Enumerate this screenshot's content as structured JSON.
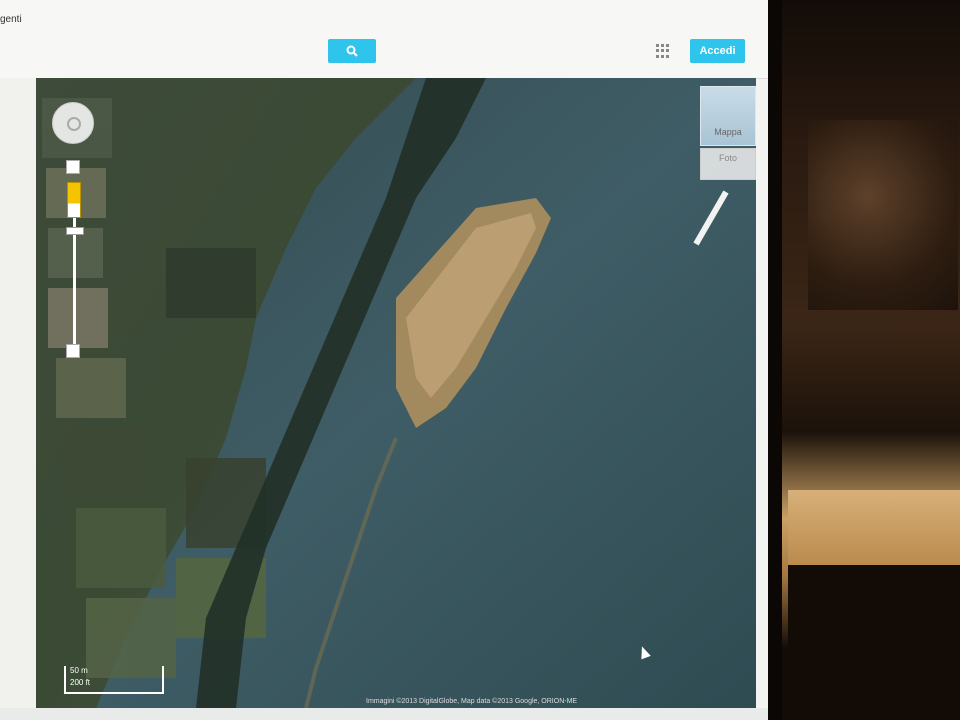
{
  "search": {
    "value": "genti",
    "placeholder": ""
  },
  "header": {
    "search_icon": "search-icon",
    "apps_icon": "apps-grid-icon",
    "signin_label": "Accedi",
    "accent": "#2ec4ec"
  },
  "map_controls": {
    "map_type_label": "Mappa",
    "photos_label": "Foto",
    "scale_top": "50 m",
    "scale_bottom": "200 ft",
    "zoom_level": 0.07
  },
  "attribution": "Immagini ©2013 DigitalGlobe, Map data ©2013 Google, ORION-ME"
}
